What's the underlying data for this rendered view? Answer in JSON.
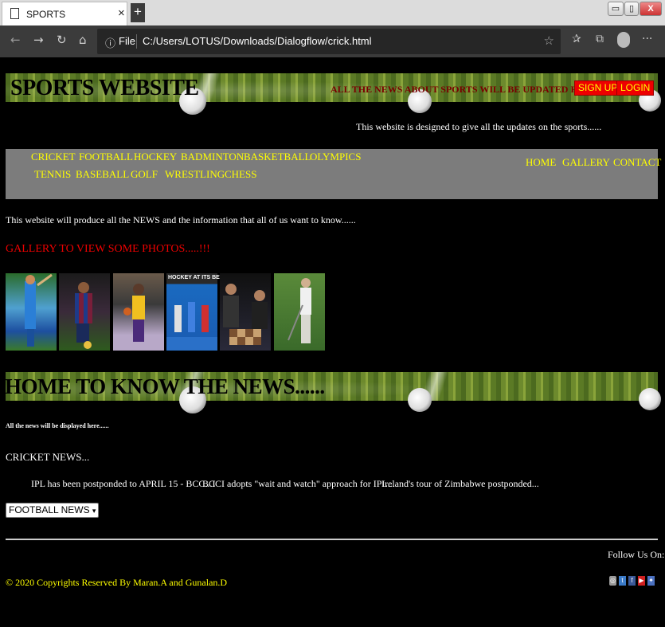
{
  "browser": {
    "tab_title": "SPORTS",
    "tab_close": "×",
    "new_tab": "+",
    "url_label": "File",
    "url_path": "C:/Users/LOTUS/Downloads/Dialogflow/crick.html",
    "win_min": "▭",
    "win_max": "▯",
    "win_close": "X",
    "more": "···"
  },
  "header": {
    "site_title": "SPORTS WEBSITE",
    "tagline": "ALL THE NEWS ABOUT SPORTS WILL BE UPDATED HERE......",
    "heart": "♥",
    "signup": "SIGN UP",
    "login": "LOGIN",
    "intro": "This website is designed to give all the updates on the sports......"
  },
  "nav": {
    "sports_row1": [
      "CRICKET",
      "FOOTBALL",
      "HOCKEY",
      "BADMINTON",
      "BASKETBALL",
      "OLYMPICS"
    ],
    "sports_row2": [
      "TENNIS",
      "BASEBALL",
      "GOLF",
      "WRESTLING",
      "CHESS"
    ],
    "right": [
      "HOME",
      "GALLERY",
      "CONTACT"
    ]
  },
  "body": {
    "description": "This website will produce all the NEWS and the information that all of us want to know......",
    "gallery_link": "GALLERY TO VIEW SOME PHOTOS.....!!!",
    "hockey_caption": "HOCKEY AT ITS BEST"
  },
  "news": {
    "heading": "HOME TO KNOW THE NEWS......",
    "subtext": "All the news will be displayed here......",
    "section_title": "CRICKET NEWS...",
    "items": [
      "IPL has been postponded to APRIL 15 - BCC...I",
      "BCCI adopts \"wait and watch\" approach for IPL...",
      "Ireland's tour of Zimbabwe postponded..."
    ],
    "dropdown_value": "FOOTBALL NEWS"
  },
  "footer": {
    "follow": "Follow Us On:",
    "copyright": "© 2020 Copyrights Reserved By Maran.A and Gunalan.D"
  },
  "colors": {
    "menu_text": "#ffff00",
    "menu_bg": "#7c7c7c",
    "accent_red": "#ee0000",
    "page_bg": "#000000"
  }
}
